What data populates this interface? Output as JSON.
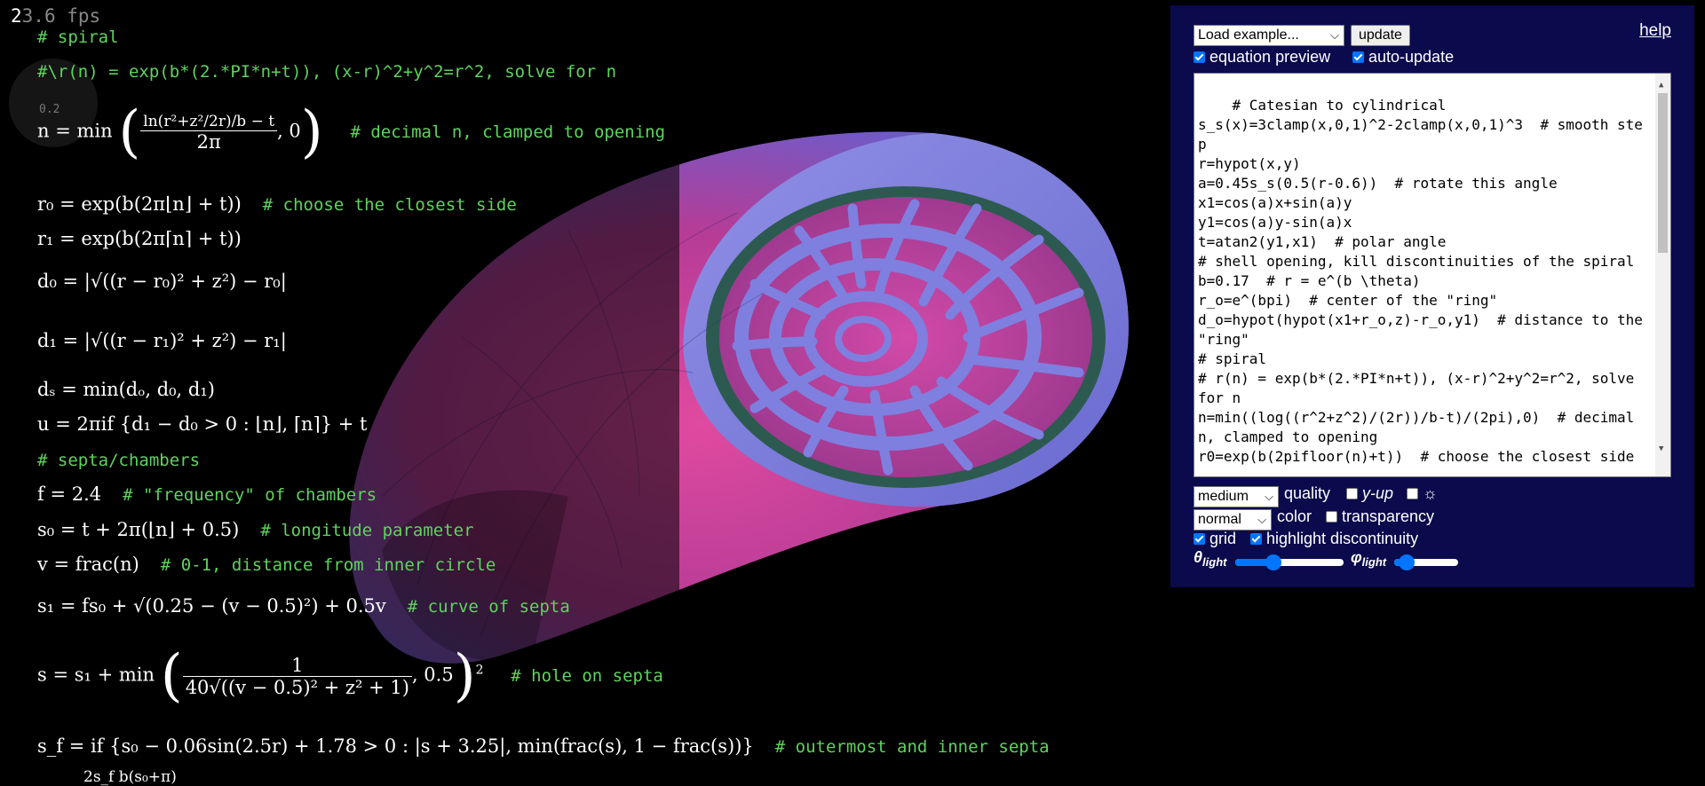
{
  "fps": {
    "first_digit": "2",
    "rest": "3.6 fps"
  },
  "mini_chart_label": "0.2",
  "equations": {
    "spiral_comment": "# spiral",
    "rn_comment": "#\\r(n) = exp(b*(2.*PI*n+t)), (x-r)^2+y^2=r^2, solve for n",
    "n_lhs": "n = min",
    "n_num": "ln(r²+z²/2r)/b − t",
    "n_den": "2π",
    "n_tail": ", 0",
    "n_comment": "# decimal n, clamped to opening",
    "r0": "r₀ = exp(b(2π⌊n⌋ + t))",
    "r0_comment": "# choose the closest side",
    "r1": "r₁ = exp(b(2π⌈n⌉ + t))",
    "d0": "d₀ = |√((r − r₀)² + z²) − r₀|",
    "d1": "d₁ = |√((r − r₁)² + z²) − r₁|",
    "ds": "dₛ = min(dₒ, d₀, d₁)",
    "u": "u = 2πif {d₁ − d₀ > 0 : ⌊n⌋, ⌈n⌉} + t",
    "septa_comment": "# septa/chambers",
    "f": "f = 2.4",
    "f_comment": "# \"frequency\" of chambers",
    "s0": "s₀ = t + 2π(⌊n⌋ + 0.5)",
    "s0_comment": "# longitude parameter",
    "v": "v = frac(n)",
    "v_comment": "# 0-1, distance from inner circle",
    "s1": "s₁ = fs₀ + √(0.25 − (v − 0.5)²) + 0.5v",
    "s1_comment": "# curve of septa",
    "s_lhs": "s = s₁ + min",
    "s_num": "1",
    "s_den": "40√((v − 0.5)² + z² + 1)",
    "s_tail": ", 0.5",
    "s_sup": "2",
    "s_comment": "# hole on septa",
    "sf": "s_f = if {s₀ − 0.06sin(2.5r) + 1.78 > 0 : |s + 3.25|, min(frac(s), 1 − frac(s))}",
    "sf_comment": "# outermost and inner septa",
    "last": "2s_f  b(s₀+π)"
  },
  "panel": {
    "example_select": "Load example...",
    "update_button": "update",
    "help_link": "help",
    "equation_preview": {
      "label": "equation preview",
      "checked": true
    },
    "auto_update": {
      "label": "auto-update",
      "checked": true
    },
    "code": "# Catesian to cylindrical\ns_s(x)=3clamp(x,0,1)^2-2clamp(x,0,1)^3  # smooth step\nr=hypot(x,y)\na=0.45s_s(0.5(r-0.6))  # rotate this angle\nx1=cos(a)x+sin(a)y\ny1=cos(a)y-sin(a)x\nt=atan2(y1,x1)  # polar angle\n# shell opening, kill discontinuities of the spiral\nb=0.17  # r = e^(b \\theta)\nr_o=e^(bpi)  # center of the \"ring\"\nd_o=hypot(hypot(x1+r_o,z)-r_o,y1)  # distance to the \"ring\"\n# spiral\n# r(n) = exp(b*(2.*PI*n+t)), (x-r)^2+y^2=r^2, solve for n\nn=min((log((r^2+z^2)/(2r))/b-t)/(2pi),0)  # decimal n, clamped to opening\nr0=exp(b(2pifloor(n)+t))  # choose the closest side",
    "quality_select": "medium",
    "quality_label": "quality",
    "yup_label": "y-up",
    "sun_label": "☼",
    "color_select": "normal",
    "color_label": "color",
    "transparency_label": "transparency",
    "grid_label": "grid",
    "highlight_label": "highlight discontinuity",
    "theta_symbol": "θ",
    "phi_symbol": "φ",
    "light_sub": "light",
    "theta_light_value": 0.35,
    "phi_light_value": 0.2
  },
  "colors": {
    "panel_bg": "#0a0a4d",
    "comment": "#5fd35f",
    "shell_pink": "#d0408f",
    "shell_blue": "#7f7fe0",
    "accent": "#0075ff"
  }
}
